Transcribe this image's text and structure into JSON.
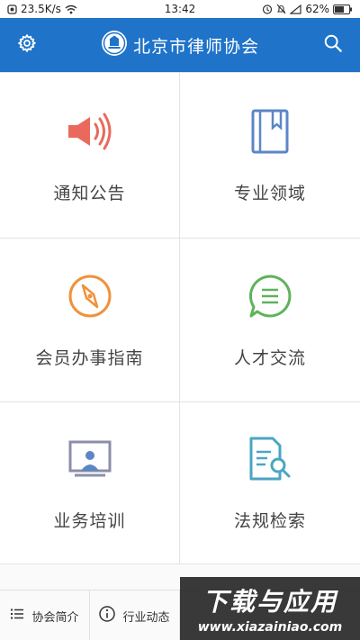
{
  "status_bar": {
    "speed": "23.5K/s",
    "time": "13:42",
    "battery": "62%"
  },
  "header": {
    "title": "北京市律师协会",
    "left_icon": "gear-icon",
    "right_icon": "search-icon",
    "logo_icon": "association-emblem-icon"
  },
  "tiles": [
    {
      "label": "通知公告",
      "icon": "megaphone-icon",
      "color": "#e96a5c"
    },
    {
      "label": "专业领域",
      "icon": "book-icon",
      "color": "#5b86c6"
    },
    {
      "label": "会员办事指南",
      "icon": "compass-icon",
      "color": "#f0923a"
    },
    {
      "label": "人才交流",
      "icon": "chat-bubble-icon",
      "color": "#5fb35a"
    },
    {
      "label": "业务培训",
      "icon": "presentation-icon",
      "color": "#8b8fa8"
    },
    {
      "label": "法规检索",
      "icon": "document-search-icon",
      "color": "#4aa6c2"
    }
  ],
  "bottom_nav": [
    {
      "label": "协会简介",
      "icon": "list-icon"
    },
    {
      "label": "行业动态",
      "icon": "info-icon"
    }
  ],
  "watermark": {
    "title": "下载与应用",
    "url": "www.xiazainiao.com"
  },
  "colors": {
    "header_bg": "#1f73c9",
    "divider": "#e3e3e3"
  }
}
